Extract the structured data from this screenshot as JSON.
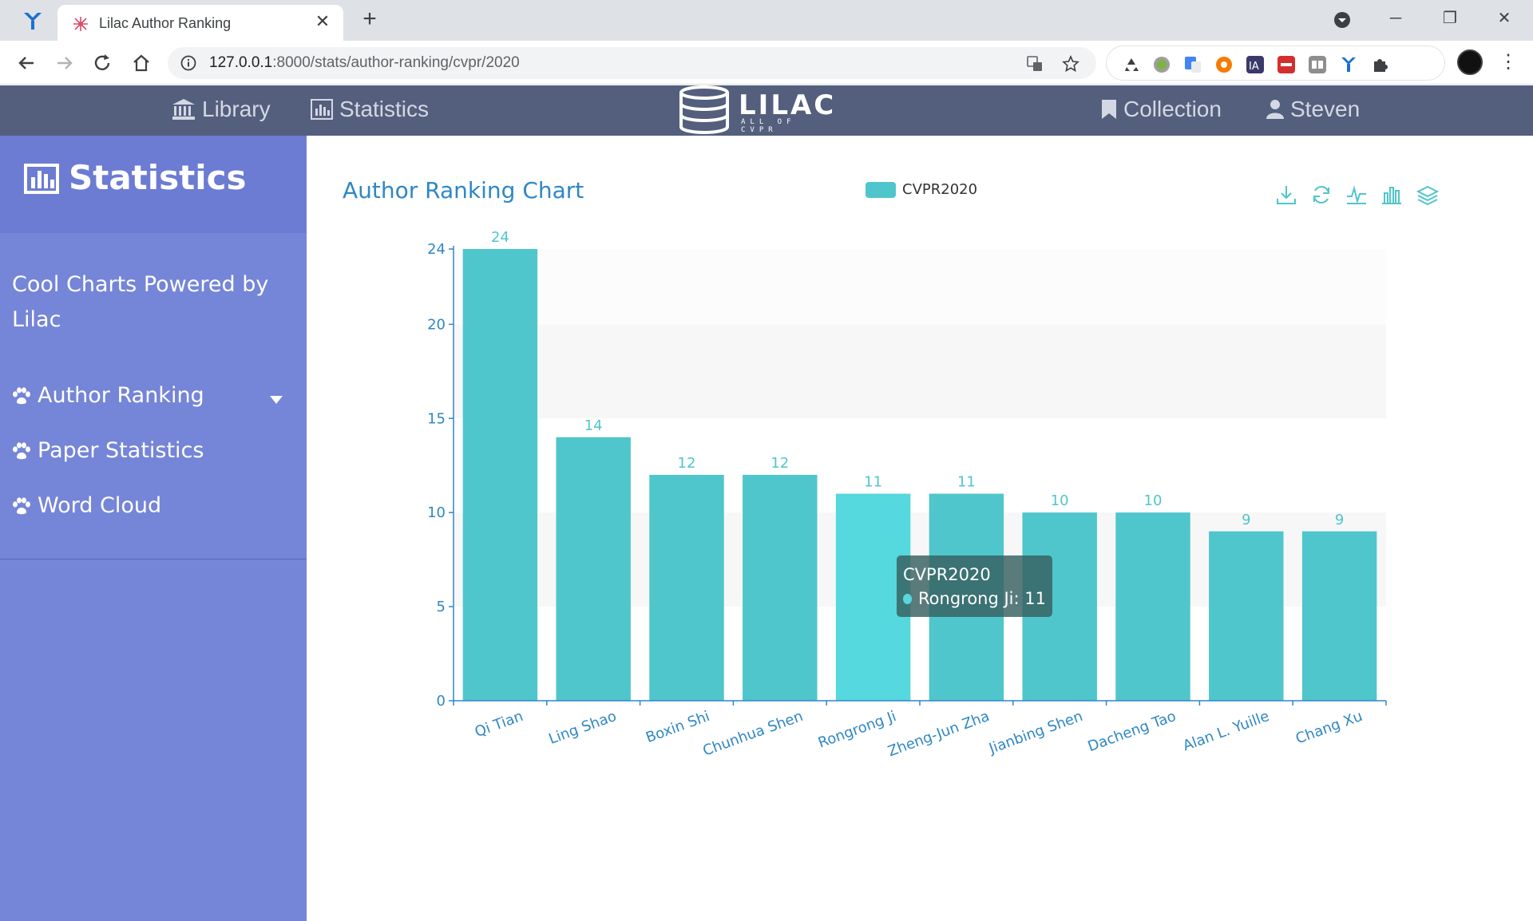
{
  "browser": {
    "tab_title": "Lilac Author Ranking",
    "new_tab_label": "+",
    "close_label": "✕",
    "url_host": "127.0.0.1",
    "url_rest": ":8000/stats/author-ranking/cvpr/2020",
    "min_label": "─",
    "restore_label": "❐",
    "winclose_label": "✕",
    "menu_label": "⋮"
  },
  "header": {
    "nav_library": "Library",
    "nav_statistics": "Statistics",
    "logo_word": "LILAC",
    "logo_sub": "ALL OF CVPR",
    "nav_collection": "Collection",
    "nav_user": "Steven"
  },
  "sidebar": {
    "title": "Statistics",
    "tagline": "Cool Charts Powered by Lilac",
    "items": [
      {
        "label": "Author Ranking"
      },
      {
        "label": "Paper Statistics"
      },
      {
        "label": "Word Cloud"
      }
    ]
  },
  "chart": {
    "title": "Author Ranking Chart",
    "legend": "CVPR2020",
    "bar_color": "#4fc6cb",
    "highlight_color": "#55d8de",
    "axis_color": "#2f87c5",
    "label_color": "#4fc6cb",
    "tools": [
      "download-icon",
      "refresh-icon",
      "line-chart-icon",
      "bar-chart-icon",
      "stack-icon"
    ]
  },
  "tooltip": {
    "series": "CVPR2020",
    "text": "Rongrong Ji: 11"
  },
  "chart_data": {
    "type": "bar",
    "categories": [
      "Qi Tian",
      "Ling Shao",
      "Boxin Shi",
      "Chunhua Shen",
      "Rongrong Ji",
      "Zheng-Jun Zha",
      "Jianbing Shen",
      "Dacheng Tao",
      "Alan L. Yuille",
      "Chang Xu"
    ],
    "series": [
      {
        "name": "CVPR2020",
        "values": [
          24,
          14,
          12,
          12,
          11,
          11,
          10,
          10,
          9,
          9
        ]
      }
    ],
    "title": "Author Ranking Chart",
    "xlabel": "",
    "ylabel": "",
    "ylim": [
      0,
      24
    ],
    "yticks": [
      0,
      5,
      10,
      15,
      20,
      24
    ],
    "legend": "top-center",
    "highlighted": "Rongrong Ji"
  }
}
